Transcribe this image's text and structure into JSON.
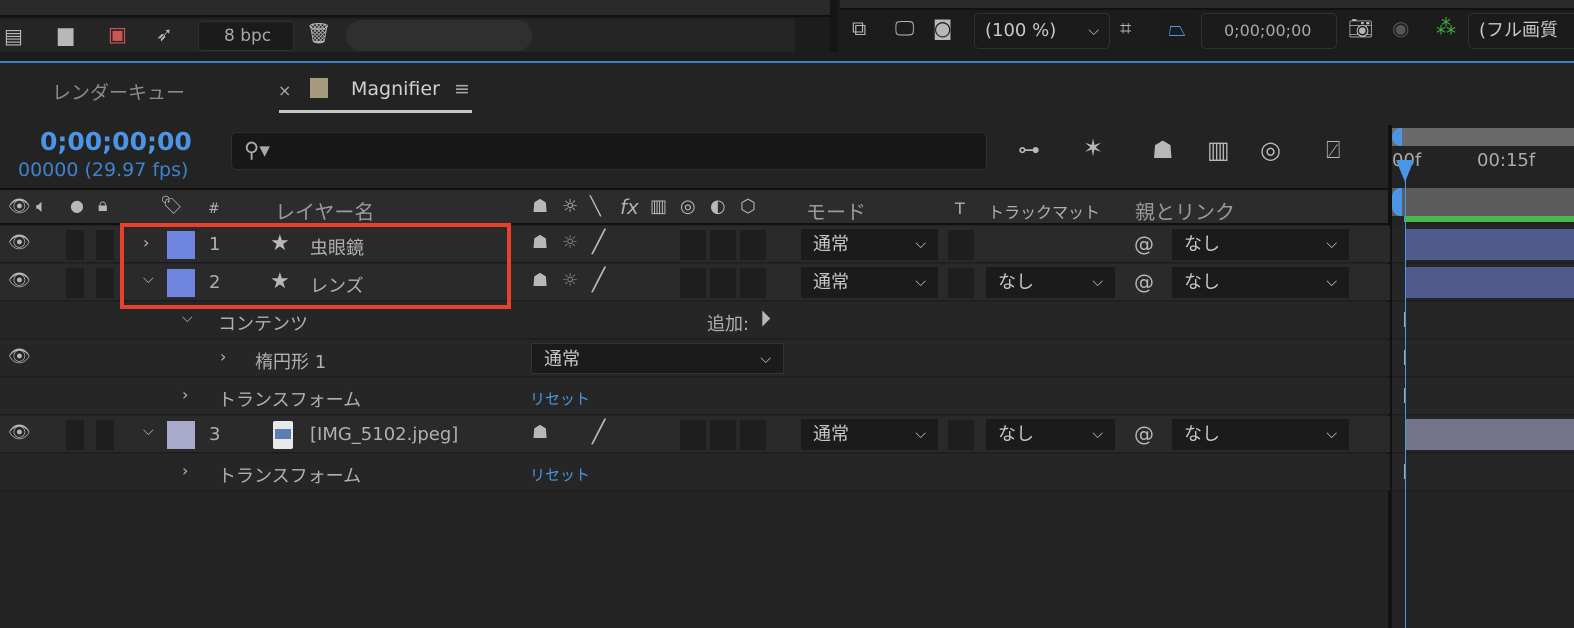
{
  "toolbar_left": {
    "bpc": "8 bpc"
  },
  "toolbar_right": {
    "zoom": "(100 %)",
    "timecode": "0;00;00;00",
    "quality": "(フル画質"
  },
  "tabs": [
    {
      "label": "レンダーキュー"
    },
    {
      "label": "Magnifier",
      "close": "×",
      "menu": "≡",
      "swatch": "#a89a7e"
    }
  ],
  "time": {
    "current": "0;00;00;00",
    "frames": "00000 (29.97 fps)",
    "color": "#4a95e6"
  },
  "search": {
    "placeholder": ""
  },
  "columns": {
    "hash": "#",
    "layer_name": "レイヤー名",
    "fx": "fx",
    "mode": "モード",
    "t": "T",
    "track_matte": "トラックマット",
    "parent": "親とリンク"
  },
  "ruler": {
    "t0": "00f",
    "t1": "00:15f"
  },
  "layers": [
    {
      "num": "1",
      "name": "虫眼鏡",
      "label_color": "#6f85e0",
      "mode": "通常",
      "matte": "",
      "parent": "なし",
      "expanded": false
    },
    {
      "num": "2",
      "name": "レンズ",
      "label_color": "#6f85e0",
      "mode": "通常",
      "matte": "なし",
      "parent": "なし",
      "expanded": true
    },
    {
      "num": "3",
      "name": "[IMG_5102.jpeg]",
      "label_color": "#a9a9cc",
      "mode": "通常",
      "matte": "なし",
      "parent": "なし",
      "expanded": true
    }
  ],
  "sub": {
    "contents": "コンテンツ",
    "add": "追加:",
    "ellipse": "楕円形 1",
    "ellipse_mode": "通常",
    "transform": "トランスフォーム",
    "reset": "リセット",
    "transform3": "トランスフォーム",
    "reset3": "リセット"
  },
  "highlight_color": "#e8402a"
}
